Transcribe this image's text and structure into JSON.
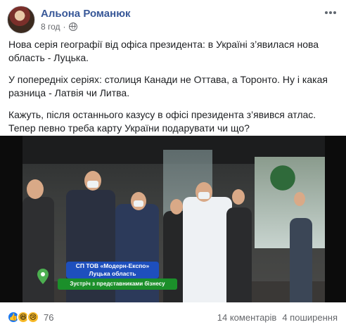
{
  "post": {
    "author": "Альона Романюк",
    "time": "8 год",
    "audience_icon": "globe-icon",
    "more_icon": "more-options-icon",
    "paragraphs": [
      "Нова серія географії від офіса президента: в Україні з’явилася нова область - Луцька.",
      "У попередніх серіях: столиця Канади не Оттава, а Торонто. Ну і какая разница - Латвія чи Литва.",
      "Кажуть, після останнього казусу в офісі президента з’явився атлас. Тепер певно треба карту України подарувати чи що?"
    ],
    "video": {
      "caption_line1": "СП ТОВ «Модерн-Експо»",
      "caption_line2": "Луцька область",
      "caption_banner": "Зустріч з представниками бізнесу",
      "colors": {
        "caption_blue": "#1e4fbd",
        "caption_green": "#1b8f2a",
        "pin_green": "#4caf50"
      }
    },
    "reactions": {
      "icons": [
        "like-icon",
        "haha-icon",
        "sad-icon"
      ],
      "count": "76"
    },
    "comments": "14 коментарів",
    "shares": "4 поширення"
  },
  "colors": {
    "author_link": "#385898",
    "secondary_text": "#65676b",
    "like_blue": "#1877f2"
  }
}
